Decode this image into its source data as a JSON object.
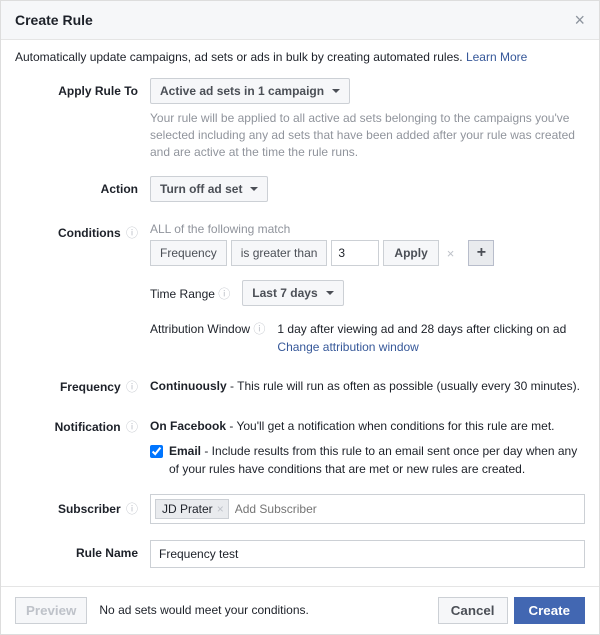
{
  "header": {
    "title": "Create Rule"
  },
  "intro": {
    "text": "Automatically update campaigns, ad sets or ads in bulk by creating automated rules.",
    "learn_more": "Learn More"
  },
  "labels": {
    "apply_rule_to": "Apply Rule To",
    "action": "Action",
    "conditions": "Conditions",
    "frequency": "Frequency",
    "notification": "Notification",
    "subscriber": "Subscriber",
    "rule_name": "Rule Name"
  },
  "apply_rule": {
    "value": "Active ad sets in 1 campaign",
    "helper": "Your rule will be applied to all active ad sets belonging to the campaigns you've selected including any ad sets that have been added after your rule was created and are active at the time the rule runs."
  },
  "action": {
    "value": "Turn off ad set"
  },
  "conditions": {
    "all_match": "ALL of the following match",
    "metric": "Frequency",
    "operator": "is greater than",
    "value": "3",
    "apply": "Apply",
    "time_range_label": "Time Range",
    "time_range_value": "Last 7 days",
    "attribution_label": "Attribution Window",
    "attribution_value": "1 day after viewing ad and 28 days after clicking on ad",
    "attribution_link": "Change attribution window"
  },
  "frequency": {
    "mode": "Continuously",
    "desc": " - This rule will run as often as possible (usually every 30 minutes)."
  },
  "notification": {
    "mode": "On Facebook",
    "desc": " - You'll get a notification when conditions for this rule are met.",
    "email_label": "Email",
    "email_desc": " - Include results from this rule to an email sent once per day when any of your rules have conditions that are met or new rules are created.",
    "email_checked": true
  },
  "subscriber": {
    "chip": "JD Prater",
    "placeholder": "Add Subscriber"
  },
  "rule_name": {
    "value": "Frequency test"
  },
  "footer": {
    "preview": "Preview",
    "message": "No ad sets would meet your conditions.",
    "cancel": "Cancel",
    "create": "Create"
  }
}
